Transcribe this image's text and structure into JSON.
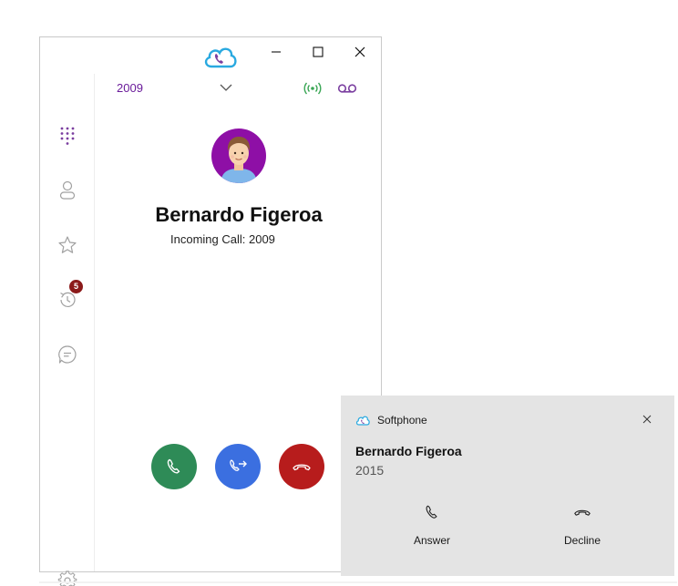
{
  "window": {
    "extension": "2009",
    "caller_name": "Bernardo Figeroa",
    "call_status": "Incoming Call: 2009",
    "history_badge": "5"
  },
  "sidebar": {
    "items": [
      {
        "name": "dialpad",
        "icon": "dialpad-icon"
      },
      {
        "name": "contacts",
        "icon": "person-icon"
      },
      {
        "name": "favorites",
        "icon": "star-icon"
      },
      {
        "name": "history",
        "icon": "history-icon"
      },
      {
        "name": "chat",
        "icon": "chat-icon"
      },
      {
        "name": "settings",
        "icon": "gear-icon"
      }
    ]
  },
  "toast": {
    "app_name": "Softphone",
    "caller_name": "Bernardo Figeroa",
    "caller_number": "2015",
    "answer_label": "Answer",
    "decline_label": "Decline"
  },
  "colors": {
    "accent_purple": "#6a1b9a",
    "answer_green": "#2e8b57",
    "transfer_blue": "#3b6fe0",
    "decline_red": "#b71c1c",
    "badge_red": "#8b1a1a",
    "signal_green": "#3aa655",
    "toast_bg": "#e4e4e4"
  }
}
